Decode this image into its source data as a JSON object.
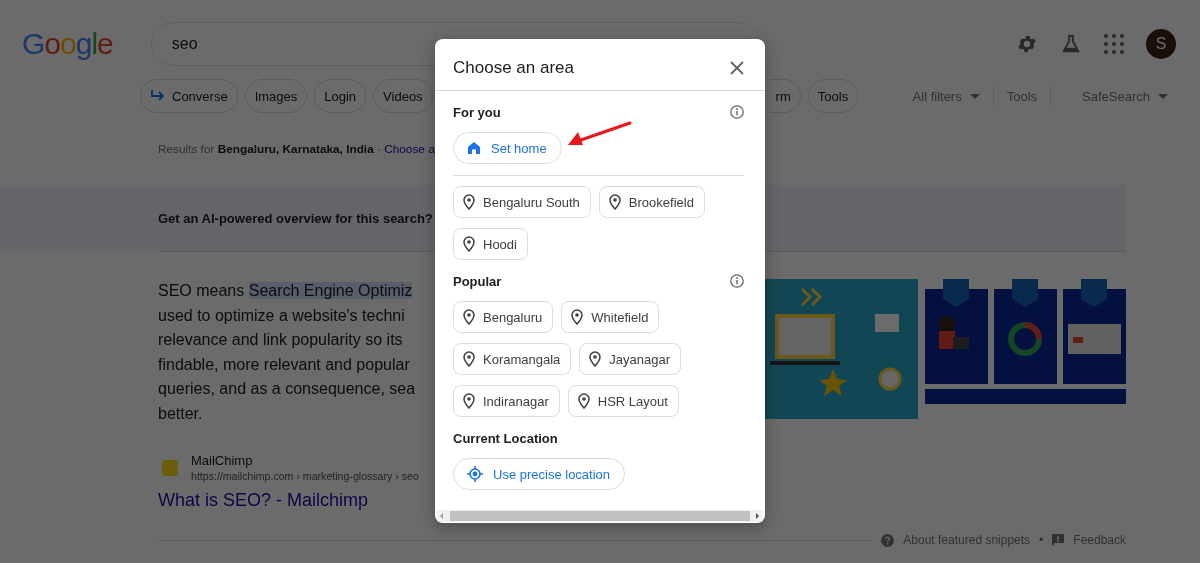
{
  "header": {
    "logo": "Google",
    "search": {
      "value": "seo"
    },
    "avatar": "S"
  },
  "chips": [
    {
      "label": "Converse",
      "kind": "icon"
    },
    {
      "label": "Images",
      "kind": "plain"
    },
    {
      "label": "Login",
      "kind": "plain"
    },
    {
      "label": "Videos",
      "kind": "plain"
    },
    {
      "label": "rm",
      "kind": "cut"
    },
    {
      "label": "Tools",
      "kind": "plain"
    }
  ],
  "filters": [
    {
      "label": "All filters",
      "dropdown": true
    },
    {
      "label": "Tools",
      "dropdown": false
    },
    {
      "label": "SafeSearch",
      "dropdown": true
    }
  ],
  "location_line": {
    "text": "Results for **Bengaluru, Karnataka, India** ·",
    "link": "Choose a"
  },
  "ai_prompt": "Get an AI-powered overview for this search?",
  "snippet": {
    "lead": "SEO means ",
    "highlighted": "Search Engine Optimiz",
    "lines": [
      "used to optimize a website's techni",
      "relevance and link popularity so its",
      "findable, more relevant and popular",
      "queries, and as a consequence, sea",
      "better."
    ]
  },
  "source": {
    "name": "MailChimp",
    "url": "https://mailchimp.com › marketing-glossary › seo",
    "title": "What is SEO? - Mailchimp"
  },
  "footer": {
    "about": "About featured snippets",
    "separator": "•",
    "feedback": "Feedback"
  },
  "dialog": {
    "title": "Choose an area",
    "sections": [
      {
        "title": "For you",
        "info": true,
        "kind": "home",
        "action": "Set home",
        "chips": [
          "Bengaluru South",
          "Brookefield",
          "Hoodi"
        ]
      },
      {
        "title": "Popular",
        "info": true,
        "kind": "places",
        "chips": [
          "Bengaluru",
          "Whitefield",
          "Koramangala",
          "Jayanagar",
          "Indiranagar",
          "HSR Layout"
        ]
      },
      {
        "title": "Current Location",
        "info": false,
        "kind": "locate",
        "action": "Use precise location"
      }
    ]
  }
}
